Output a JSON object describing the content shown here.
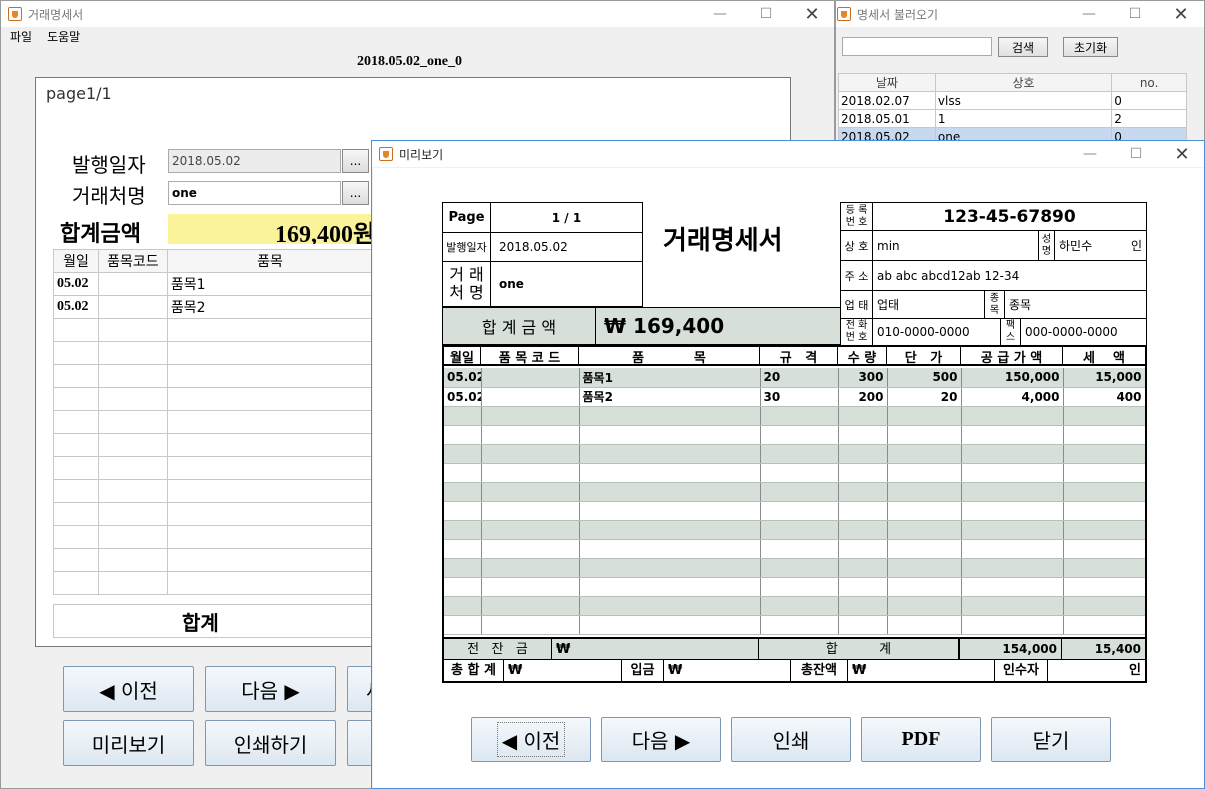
{
  "main_window": {
    "title": "거래명세서",
    "menu": [
      "파일",
      "도움말"
    ],
    "document_title": "2018.05.02_one_0",
    "page_label": "page1/1",
    "issue_date_label": "발행일자",
    "issue_date": "2018.05.02",
    "client_label": "거래처명",
    "client": "one",
    "dots": "...",
    "total_label": "합계금액",
    "total_amount": "169,400원",
    "table_headers": [
      "월일",
      "품목코드",
      "품목"
    ],
    "rows": [
      {
        "date": "05.02",
        "code": "",
        "item": "품목1"
      },
      {
        "date": "05.02",
        "code": "",
        "item": "품목2"
      }
    ],
    "sum_label": "합계",
    "buttons": {
      "prev": "◀ 이전",
      "next": "다음 ▶",
      "third": "새",
      "preview": "미리보기",
      "print": "인쇄하기"
    }
  },
  "loader_window": {
    "title": "명세서 불러오기",
    "search_value": "",
    "search_button": "검색",
    "reset_button": "초기화",
    "headers": [
      "날짜",
      "상호",
      "no."
    ],
    "rows": [
      {
        "date": "2018.02.07",
        "company": "vlss",
        "no": "0"
      },
      {
        "date": "2018.05.01",
        "company": "1",
        "no": "2"
      },
      {
        "date": "2018.05.02",
        "company": "one",
        "no": "0"
      }
    ]
  },
  "preview_window": {
    "title": "미리보기",
    "doc": {
      "page_label": "Page",
      "page_value": "1 / 1",
      "issue_date_label": "발행일자",
      "issue_date": "2018.05.02",
      "client_label_1": "거 래",
      "client_label_2": "처 명",
      "client": "one",
      "heading": "거래명세서",
      "reg_label_1": "등 록",
      "reg_label_2": "번 호",
      "reg_no": "123-45-67890",
      "company_label": "상 호",
      "company": "min",
      "name_label_1": "성",
      "name_label_2": "명",
      "name": "하민수",
      "seal": "인",
      "address_label": "주 소",
      "address": "ab abc abcd12ab 12-34",
      "biz_type_label": "업 태",
      "biz_type": "업태",
      "biz_item_label_1": "종",
      "biz_item_label_2": "목",
      "biz_item": "종목",
      "total_label": "합 계 금 액",
      "total": "₩ 169,400",
      "phone_label_1": "전 화",
      "phone_label_2": "번 호",
      "phone": "010-0000-0000",
      "fax_label_1": "팩",
      "fax_label_2": "스",
      "fax": "000-0000-0000",
      "col_headers": [
        "월일",
        "품 목 코 드",
        "품           목",
        "규   격",
        "수 량",
        "단   가",
        "공 급 가 액",
        "세    액"
      ],
      "rows": [
        [
          "05.02",
          "",
          "품목1",
          "20",
          "300",
          "500",
          "150,000",
          "15,000"
        ],
        [
          "05.02",
          "",
          "품목2",
          "30",
          "200",
          "20",
          "4,000",
          "400"
        ],
        [
          "",
          "",
          "",
          "",
          "",
          "",
          "",
          ""
        ],
        [
          "",
          "",
          "",
          "",
          "",
          "",
          "",
          ""
        ],
        [
          "",
          "",
          "",
          "",
          "",
          "",
          "",
          ""
        ],
        [
          "",
          "",
          "",
          "",
          "",
          "",
          "",
          ""
        ],
        [
          "",
          "",
          "",
          "",
          "",
          "",
          "",
          ""
        ],
        [
          "",
          "",
          "",
          "",
          "",
          "",
          "",
          ""
        ],
        [
          "",
          "",
          "",
          "",
          "",
          "",
          "",
          ""
        ],
        [
          "",
          "",
          "",
          "",
          "",
          "",
          "",
          ""
        ],
        [
          "",
          "",
          "",
          "",
          "",
          "",
          "",
          ""
        ],
        [
          "",
          "",
          "",
          "",
          "",
          "",
          "",
          ""
        ],
        [
          "",
          "",
          "",
          "",
          "",
          "",
          "",
          ""
        ],
        [
          "",
          "",
          "",
          "",
          "",
          "",
          "",
          ""
        ]
      ],
      "prev_balance_label": "전   잔   금",
      "prev_balance": "₩",
      "sum_label": "합          계",
      "sum_supply": "154,000",
      "sum_tax": "15,400",
      "grand_label": "총 합 계",
      "grand": "₩",
      "deposit_label": "입금",
      "deposit": "₩",
      "balance_label": "총잔액",
      "balance": "₩",
      "receiver_label": "인수자",
      "receiver_seal": "인"
    },
    "buttons": {
      "prev": "◀ 이전",
      "next": "다음 ▶",
      "print": "인쇄",
      "pdf": "PDF",
      "close": "닫기"
    }
  }
}
